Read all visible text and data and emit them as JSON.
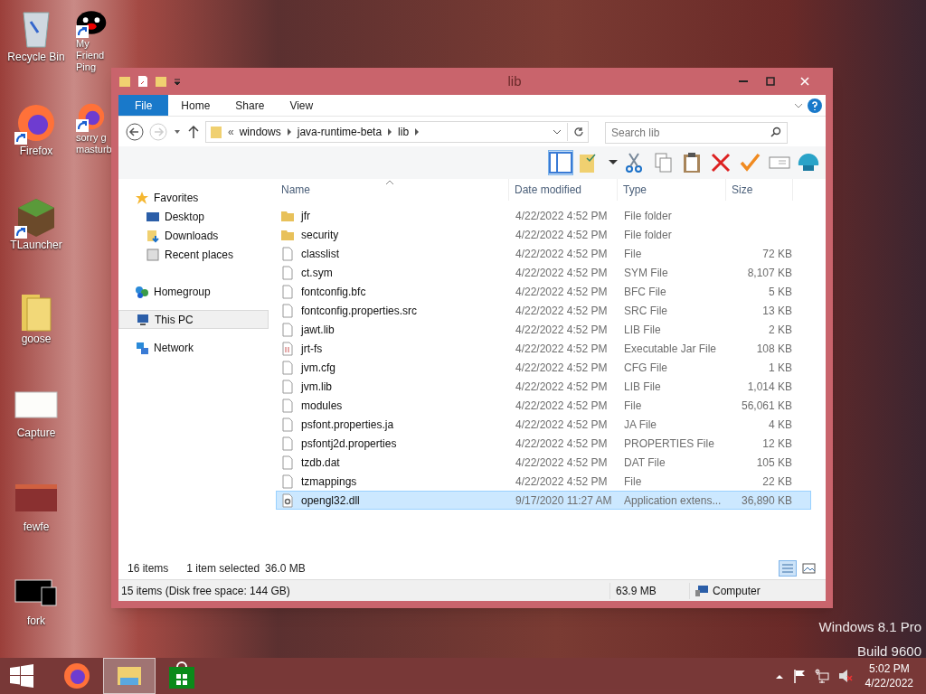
{
  "desktop_icons": [
    {
      "kind": "recycle",
      "label": "Recycle Bin",
      "shortcut": false
    },
    {
      "kind": "penguin",
      "label": "My Friend Ping",
      "shortcut": true
    },
    {
      "kind": "firefox",
      "label": "Firefox",
      "shortcut": true
    },
    {
      "kind": "firefox",
      "label": "sorry g masturb",
      "shortcut": true
    },
    {
      "kind": "block",
      "label": "TLauncher",
      "shortcut": true
    },
    {
      "kind": "folder",
      "label": "goose",
      "shortcut": false
    },
    {
      "kind": "image",
      "label": "Capture",
      "shortcut": false
    },
    {
      "kind": "screenshot",
      "label": "fewfe",
      "shortcut": false
    },
    {
      "kind": "dark",
      "label": "fork",
      "shortcut": false
    }
  ],
  "window": {
    "title": "lib",
    "ribbon_tabs": [
      {
        "label": "File",
        "selected": true
      },
      {
        "label": "Home",
        "selected": false
      },
      {
        "label": "Share",
        "selected": false
      },
      {
        "label": "View",
        "selected": false
      }
    ],
    "address": {
      "overflow": "«",
      "crumbs": [
        "windows",
        "java-runtime-beta",
        "lib"
      ]
    },
    "search": {
      "placeholder": "Search lib"
    },
    "nav": [
      {
        "kind": "favorites",
        "label": "Favorites",
        "selected": false,
        "children": [
          {
            "kind": "desktop",
            "label": "Desktop",
            "selected": false
          },
          {
            "kind": "downloads",
            "label": "Downloads",
            "selected": false
          },
          {
            "kind": "recent",
            "label": "Recent places",
            "selected": false
          }
        ]
      },
      {
        "kind": "homegroup",
        "label": "Homegroup",
        "selected": false
      },
      {
        "kind": "pc",
        "label": "This PC",
        "selected": true
      },
      {
        "kind": "network",
        "label": "Network",
        "selected": false
      }
    ],
    "columns": [
      "Name",
      "Date modified",
      "Type",
      "Size"
    ],
    "files": [
      {
        "kind": "folder",
        "name": "jfr",
        "date": "4/22/2022 4:52 PM",
        "type": "File folder",
        "selected": false
      },
      {
        "kind": "folder",
        "name": "security",
        "date": "4/22/2022 4:52 PM",
        "type": "File folder",
        "selected": false
      },
      {
        "kind": "file",
        "name": "classlist",
        "date": "4/22/2022 4:52 PM",
        "type": "File",
        "size": "72 KB",
        "selected": false
      },
      {
        "kind": "file",
        "name": "ct.sym",
        "date": "4/22/2022 4:52 PM",
        "type": "SYM File",
        "size": "8,107 KB",
        "selected": false
      },
      {
        "kind": "file",
        "name": "fontconfig.bfc",
        "date": "4/22/2022 4:52 PM",
        "type": "BFC File",
        "size": "5 KB",
        "selected": false
      },
      {
        "kind": "file",
        "name": "fontconfig.properties.src",
        "date": "4/22/2022 4:52 PM",
        "type": "SRC File",
        "size": "13 KB",
        "selected": false
      },
      {
        "kind": "file",
        "name": "jawt.lib",
        "date": "4/22/2022 4:52 PM",
        "type": "LIB File",
        "size": "2 KB",
        "selected": false
      },
      {
        "kind": "jar",
        "name": "jrt-fs",
        "date": "4/22/2022 4:52 PM",
        "type": "Executable Jar File",
        "size": "108 KB",
        "selected": false
      },
      {
        "kind": "file",
        "name": "jvm.cfg",
        "date": "4/22/2022 4:52 PM",
        "type": "CFG File",
        "size": "1 KB",
        "selected": false
      },
      {
        "kind": "file",
        "name": "jvm.lib",
        "date": "4/22/2022 4:52 PM",
        "type": "LIB File",
        "size": "1,014 KB",
        "selected": false
      },
      {
        "kind": "file",
        "name": "modules",
        "date": "4/22/2022 4:52 PM",
        "type": "File",
        "size": "56,061 KB",
        "selected": false
      },
      {
        "kind": "file",
        "name": "psfont.properties.ja",
        "date": "4/22/2022 4:52 PM",
        "type": "JA File",
        "size": "4 KB",
        "selected": false
      },
      {
        "kind": "file",
        "name": "psfontj2d.properties",
        "date": "4/22/2022 4:52 PM",
        "type": "PROPERTIES File",
        "size": "12 KB",
        "selected": false
      },
      {
        "kind": "file",
        "name": "tzdb.dat",
        "date": "4/22/2022 4:52 PM",
        "type": "DAT File",
        "size": "105 KB",
        "selected": false
      },
      {
        "kind": "file",
        "name": "tzmappings",
        "date": "4/22/2022 4:52 PM",
        "type": "File",
        "size": "22 KB",
        "selected": false
      },
      {
        "kind": "dll",
        "name": "opengl32.dll",
        "date": "9/17/2020 11:27 AM",
        "type": "Application extens...",
        "size": "36,890 KB",
        "selected": true
      }
    ],
    "status": {
      "count": "16 items",
      "selection": "1 item selected",
      "selection_size": "36.0 MB"
    },
    "status_bar": {
      "info": "15 items (Disk free space: 144 GB)",
      "size": "63.9 MB",
      "location": "Computer"
    }
  },
  "watermark": [
    "Windows 8.1 Pro",
    "Build 9600"
  ],
  "taskbar": {
    "apps": [
      {
        "kind": "firefox",
        "active": false
      },
      {
        "kind": "explorer",
        "active": true
      },
      {
        "kind": "store",
        "active": false
      }
    ],
    "clock": {
      "time": "5:02 PM",
      "date": "4/22/2022"
    }
  }
}
